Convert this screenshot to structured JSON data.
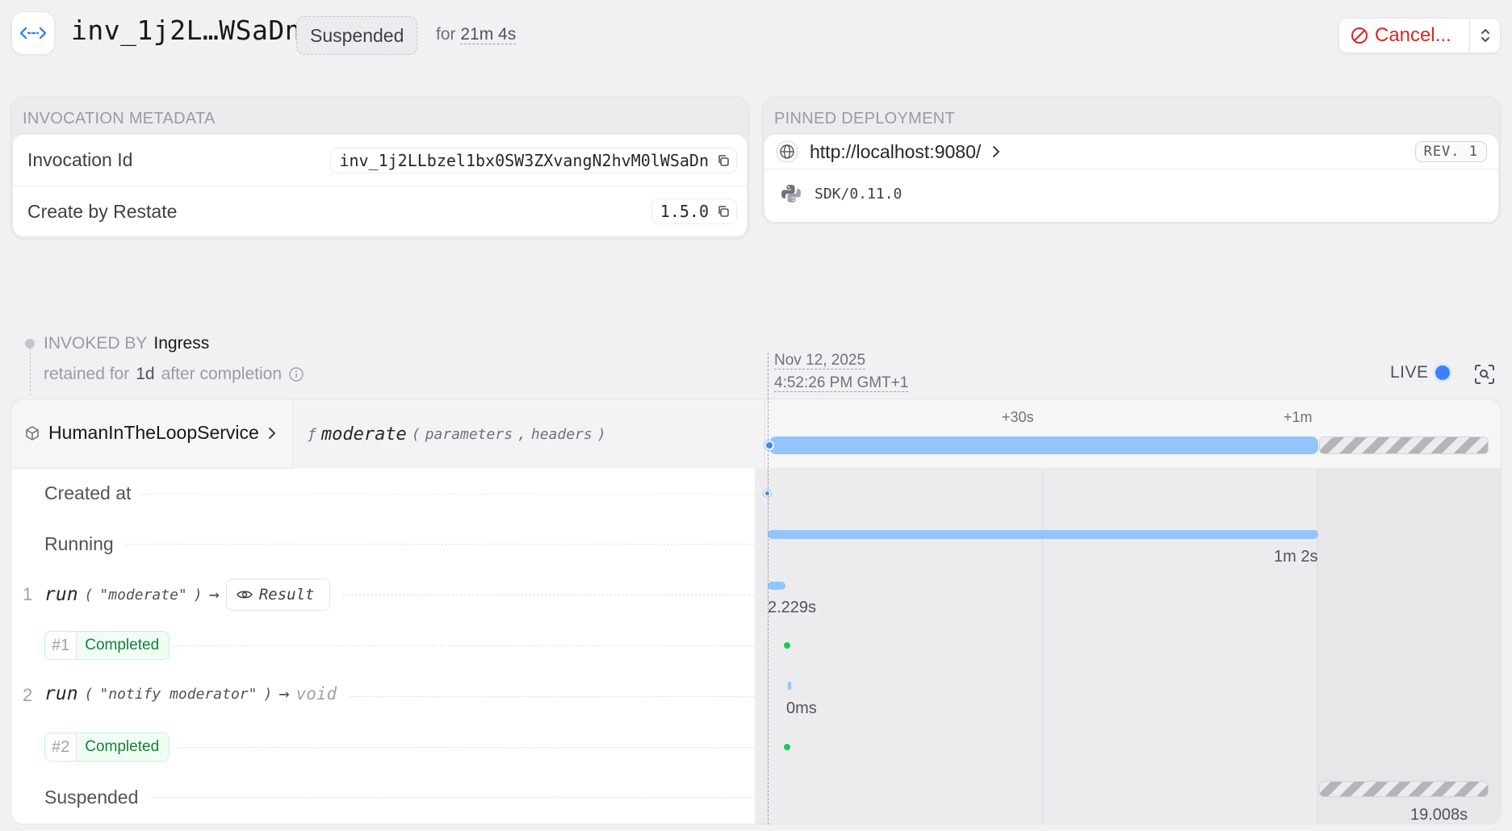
{
  "header": {
    "icon": "arrows-icon",
    "title": "inv_1j2L…WSaDn",
    "status": "Suspended",
    "for_prefix": "for",
    "duration": "21m 4s",
    "cancel_label": "Cancel...",
    "cancel_color": "#dc2626"
  },
  "metadata": {
    "title": "INVOCATION METADATA",
    "rows": [
      {
        "label": "Invocation Id",
        "value": "inv_1j2LLbzel1bx0SW3ZXvangN2hvM0lWSaDn"
      },
      {
        "label": "Create by Restate",
        "value": "1.5.0"
      }
    ]
  },
  "deployment": {
    "title": "PINNED DEPLOYMENT",
    "url": "http://localhost:9080/",
    "revision": "REV. 1",
    "sdk": "SDK/0.11.0"
  },
  "invoked": {
    "label": "INVOKED BY",
    "by": "Ingress",
    "retained_prefix": "retained for",
    "retained_value": "1d",
    "retained_suffix": "after completion"
  },
  "timeline": {
    "date": "Nov 12, 2025",
    "time": "4:52:26 PM GMT+1",
    "live_label": "LIVE",
    "accent": "#93c5fd",
    "service": "HumanInTheLoopService",
    "handler": "moderate",
    "params": [
      "parameters",
      "headers"
    ],
    "ticks": [
      "+30s",
      "+1m"
    ],
    "rows": {
      "created_at": "Created at",
      "running": "Running",
      "running_duration": "1m 2s",
      "suspended": "Suspended",
      "suspended_duration": "19.008s"
    },
    "steps": [
      {
        "num": "1",
        "fn": "run",
        "arg": "\"moderate\"",
        "result": "Result",
        "duration": "2.229s",
        "badge_num": "#1",
        "badge_status": "Completed"
      },
      {
        "num": "2",
        "fn": "run",
        "arg": "\"notify moderator\"",
        "result": "void",
        "duration": "0ms",
        "badge_num": "#2",
        "badge_status": "Completed"
      }
    ]
  }
}
